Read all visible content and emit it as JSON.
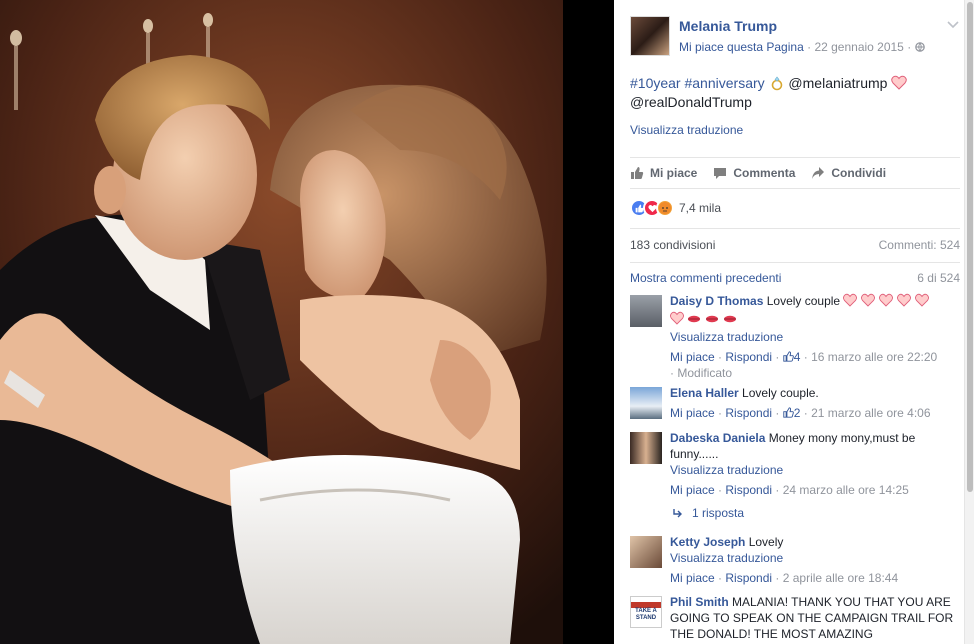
{
  "post": {
    "page_name": "Melania Trump",
    "like_page": "Mi piace questa Pagina",
    "date": "22 gennaio 2015",
    "hashtag1": "#10year",
    "hashtag2": "#anniversary",
    "mention1": "@melaniatrump",
    "mention2": "@realDonaldTrump",
    "translate": "Visualizza traduzione"
  },
  "actions": {
    "like": "Mi piace",
    "comment": "Commenta",
    "share": "Condividi"
  },
  "stats": {
    "reactions_count": "7,4 mila",
    "shares": "183 condivisioni",
    "comments": "Commenti: 524",
    "show_previous": "Mostra commenti precedenti",
    "page_count": "6 di 524"
  },
  "comments": [
    {
      "name": "Daisy D Thomas",
      "text": "Lovely couple",
      "translate": "Visualizza traduzione",
      "like": "Mi piace",
      "reply": "Rispondi",
      "likes": "4",
      "date": "16 marzo alle ore 22:20",
      "edited": "Modificato"
    },
    {
      "name": "Elena Haller",
      "text": "Lovely couple.",
      "like": "Mi piace",
      "reply": "Rispondi",
      "likes": "2",
      "date": "21 marzo alle ore 4:06"
    },
    {
      "name": "Dabeska Daniela",
      "text": "Money mony mony,must be funny......",
      "translate": "Visualizza traduzione",
      "like": "Mi piace",
      "reply": "Rispondi",
      "date": "24 marzo alle ore 14:25",
      "replies": "1 risposta"
    },
    {
      "name": "Ketty Joseph",
      "text": "Lovely",
      "translate": "Visualizza traduzione",
      "like": "Mi piace",
      "reply": "Rispondi",
      "date": "2 aprile alle ore 18:44"
    },
    {
      "name": "Phil Smith",
      "text": "MALANIA! THANK YOU THAT YOU ARE GOING TO SPEAK ON THE CAMPAIGN TRAIL FOR THE DONALD! THE MOST AMAZING",
      "avatar_text": "TAKE A STAND"
    }
  ],
  "colors": {
    "link": "#365899",
    "muted": "#90949c",
    "text": "#1d2129"
  }
}
